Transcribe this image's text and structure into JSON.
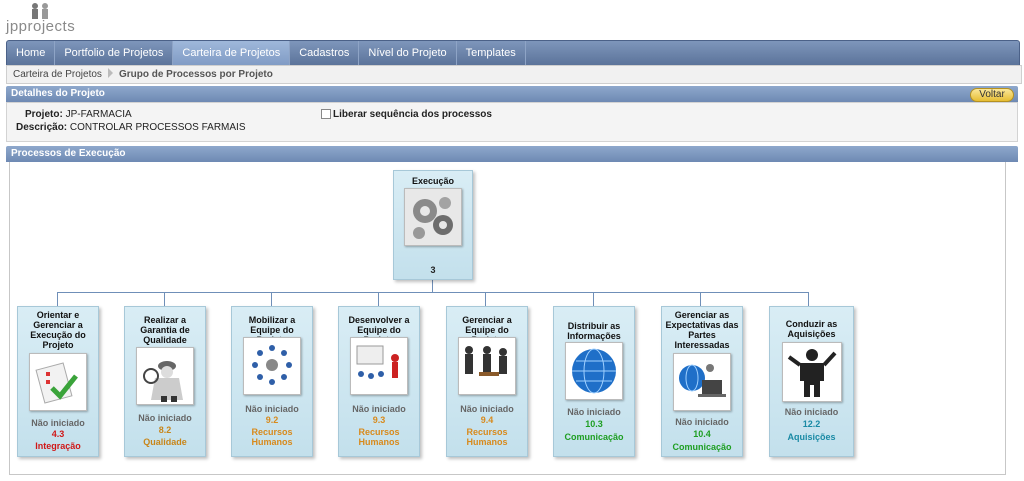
{
  "logo": {
    "text": "jpprojects"
  },
  "nav": {
    "items": [
      {
        "label": "Home"
      },
      {
        "label": "Portfolio de Projetos"
      },
      {
        "label": "Carteira de Projetos"
      },
      {
        "label": "Cadastros"
      },
      {
        "label": "Nível do Projeto"
      },
      {
        "label": "Templates"
      }
    ]
  },
  "breadcrumb": {
    "parent": "Carteira de Projetos",
    "current": "Grupo de Processos por Projeto"
  },
  "details": {
    "header": "Detalhes do Projeto",
    "back_label": "Voltar",
    "projeto_label": "Projeto:",
    "projeto_value": "JP-FARMACIA",
    "descricao_label": "Descrição:",
    "descricao_value": "CONTROLAR PROCESSOS FARMAIS",
    "liberar_label": "Liberar sequência dos processos"
  },
  "processes": {
    "header": "Processos de Execução",
    "root": {
      "title": "Execução",
      "code": "3",
      "icon": "gears-icon"
    },
    "children": [
      {
        "title": "Orientar e Gerenciar a Execução do Projeto",
        "status": "Não iniciado",
        "code": "4.3",
        "area": "Integração",
        "area_color": "#d01818",
        "icon": "checklist-icon"
      },
      {
        "title": "Realizar a Garantia de Qualidade",
        "status": "Não iniciado",
        "code": "8.2",
        "area": "Qualidade",
        "area_color": "#c8861a",
        "icon": "inspector-icon"
      },
      {
        "title": "Mobilizar a Equipe do Projeto",
        "status": "Não iniciado",
        "code": "9.2",
        "area": "Recursos Humanos",
        "area_color": "#d88a1c",
        "icon": "team-circle-icon"
      },
      {
        "title": "Desenvolver a Equipe do Projeto",
        "status": "Não iniciado",
        "code": "9.3",
        "area": "Recursos Humanos",
        "area_color": "#d88a1c",
        "icon": "presentation-icon"
      },
      {
        "title": "Gerenciar a Equipe do Projeto",
        "status": "Não iniciado",
        "code": "9.4",
        "area": "Recursos Humanos",
        "area_color": "#d88a1c",
        "icon": "meeting-icon"
      },
      {
        "title": "Distribuir as Informações",
        "status": "Não iniciado",
        "code": "10.3",
        "area": "Comunicação",
        "area_color": "#1e9e22",
        "icon": "globe-icon"
      },
      {
        "title": "Gerenciar as Expectativas das Partes Interessadas",
        "status": "Não iniciado",
        "code": "10.4",
        "area": "Comunicação",
        "area_color": "#1e9e22",
        "icon": "globe-laptop-icon"
      },
      {
        "title": "Conduzir as Aquisições",
        "status": "Não iniciado",
        "code": "12.2",
        "area": "Aquisições",
        "area_color": "#1a8aa5",
        "icon": "presenter-icon"
      }
    ]
  }
}
